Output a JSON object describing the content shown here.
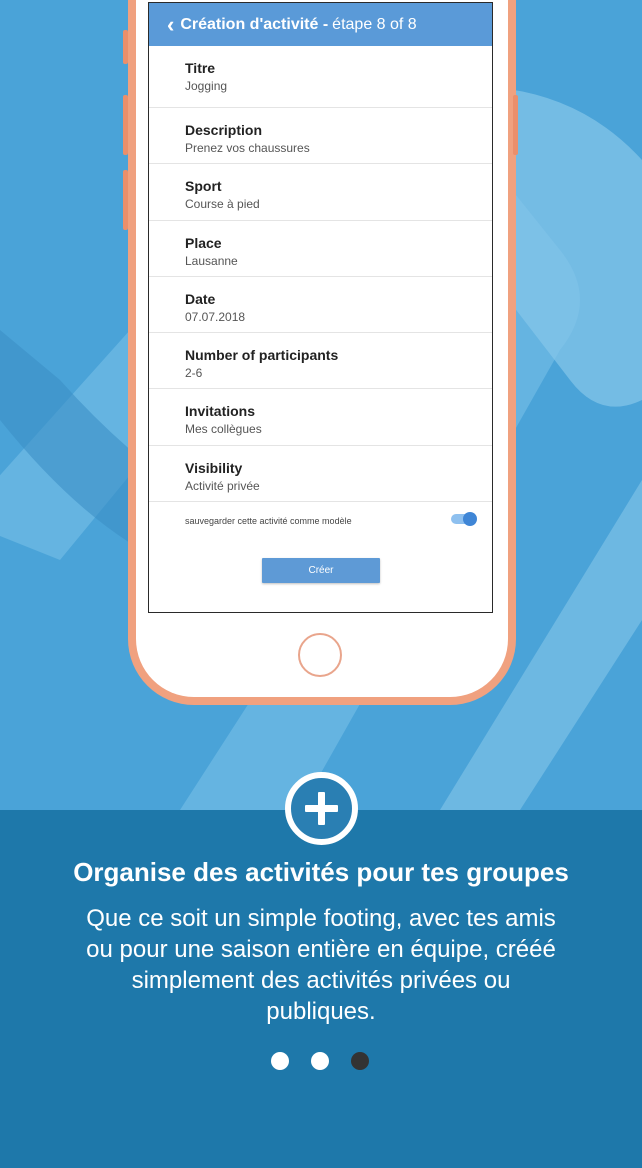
{
  "app": {
    "back_icon": "‹",
    "title": "Création d'activité -",
    "step": "étape 8 of 8"
  },
  "fields": [
    {
      "label": "Titre",
      "value": "Jogging"
    },
    {
      "label": "Description",
      "value": "Prenez vos chaussures"
    },
    {
      "label": "Sport",
      "value": "Course à pied"
    },
    {
      "label": "Place",
      "value": "Lausanne"
    },
    {
      "label": "Date",
      "value": "07.07.2018"
    },
    {
      "label": "Number of participants",
      "value": "2-6"
    },
    {
      "label": "Invitations",
      "value": "Mes collègues"
    },
    {
      "label": "Visibility",
      "value": "Activité privée"
    }
  ],
  "template_toggle": {
    "label": "sauvegarder cette activité comme modèle",
    "on": true
  },
  "create_button": "Créer",
  "promo": {
    "icon": "plus-circle-icon",
    "headline": "Organise des activités pour tes groupes",
    "body_lines": [
      "Que ce soit un simple footing, avec tes amis",
      "ou pour une saison entière en équipe, crééé",
      "simplement des activités privées ou",
      "publiques."
    ]
  },
  "pager": {
    "total": 3,
    "current": 3
  },
  "colors": {
    "background_top": "#4aa3d8",
    "background_bottom": "#1e78aa",
    "app_header": "#5a9ad8",
    "phone_frame": "#f0a17f"
  }
}
